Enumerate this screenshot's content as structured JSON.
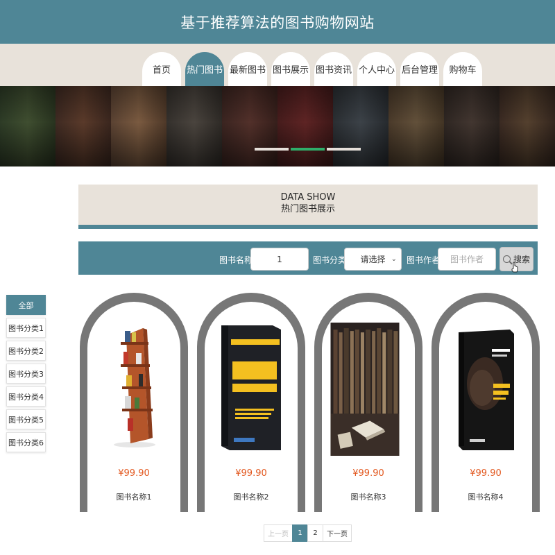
{
  "site": {
    "title": "基于推荐算法的图书购物网站"
  },
  "nav": {
    "items": [
      "首页",
      "热门图书",
      "最新图书",
      "图书展示",
      "图书资讯",
      "个人中心",
      "后台管理",
      "购物车"
    ],
    "active_index": 1
  },
  "banner": {
    "slides": 3,
    "active_index": 1
  },
  "section": {
    "title_en": "DATA SHOW",
    "title_cn": "热门图书展示"
  },
  "search": {
    "name_label": "图书名称",
    "name_value": "1",
    "category_label": "图书分类",
    "category_value": "请选择",
    "author_label": "图书作者",
    "author_placeholder": "图书作者",
    "button_label": "搜索"
  },
  "categories": [
    "全部",
    "图书分类1",
    "图书分类2",
    "图书分类3",
    "图书分类4",
    "图书分类5",
    "图书分类6"
  ],
  "categories_active_index": 0,
  "books": [
    {
      "price": "¥99.90",
      "name": "图书名称1"
    },
    {
      "price": "¥99.90",
      "name": "图书名称2",
      "cover_title": "管理",
      "cover_subtitle": "越简单越好",
      "cover_top": "GUANLI"
    },
    {
      "price": "¥99.90",
      "name": "图书名称3"
    },
    {
      "price": "¥99.90",
      "name": "图书名称4",
      "cover_subtitle": "科比传"
    }
  ],
  "pagination": {
    "prev": "上一页",
    "pages": [
      "1",
      "2"
    ],
    "active_index": 0,
    "next": "下一页"
  },
  "colors": {
    "primary": "#4f8696",
    "beige": "#e8e2da",
    "price": "#e2571e",
    "card_frame": "#777777",
    "dot_active": "#2fae6a"
  }
}
